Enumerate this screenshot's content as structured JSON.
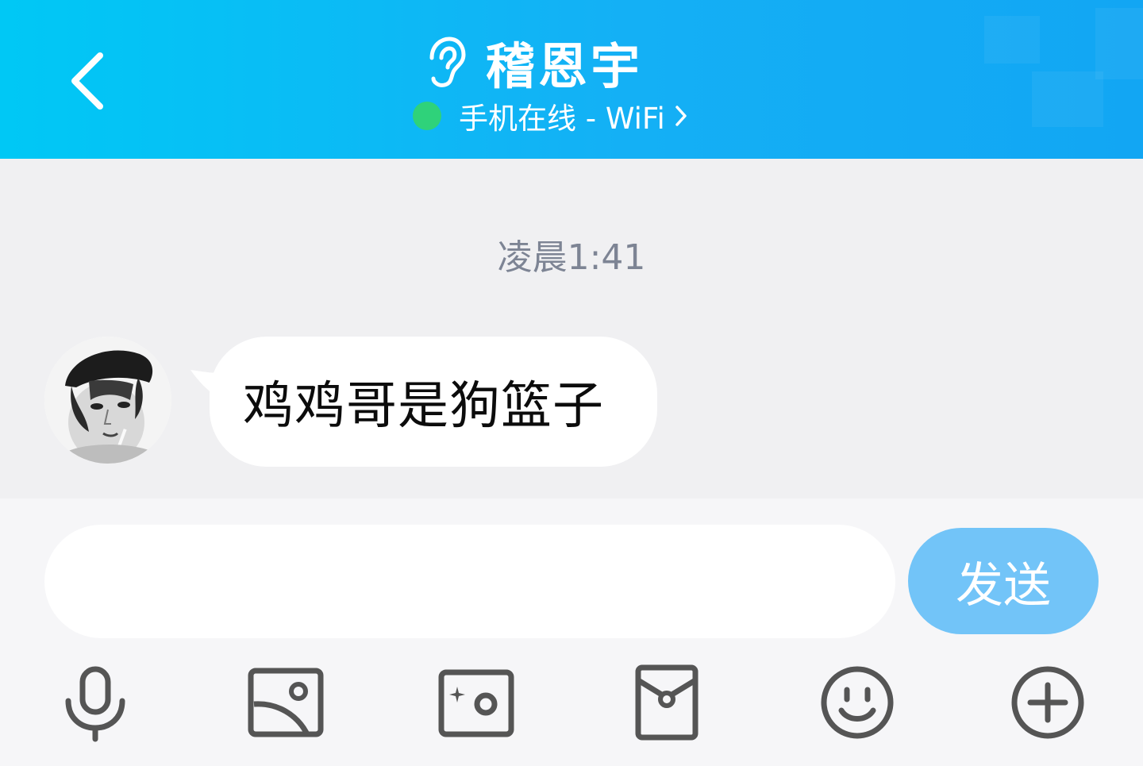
{
  "header": {
    "contact_name": "稽恩宇",
    "status": "手机在线 - WiFi",
    "back_icon": "chevron-left",
    "ear_icon": "ear",
    "online_color": "#2fd27a"
  },
  "chat": {
    "timestamp": "凌晨1:41",
    "messages": [
      {
        "sender": "contact",
        "text": "鸡鸡哥是狗篮子"
      }
    ]
  },
  "composer": {
    "input_value": "",
    "input_placeholder": "",
    "send_label": "发送",
    "send_color": "#72c4f8"
  },
  "toolbar": {
    "icons": [
      "microphone",
      "image-album",
      "camera",
      "red-packet",
      "emoji",
      "plus"
    ]
  }
}
